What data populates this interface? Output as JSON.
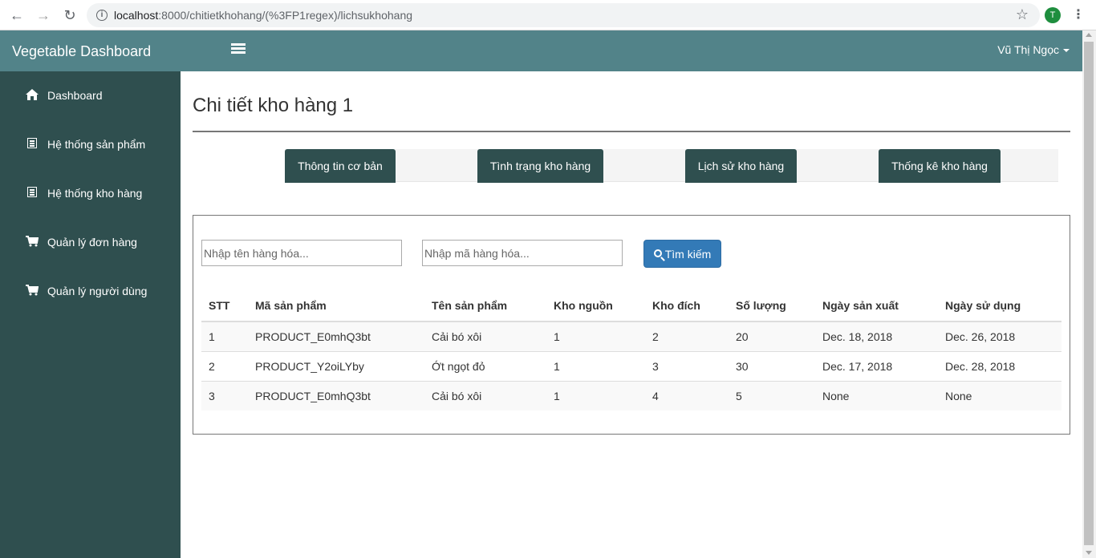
{
  "browser": {
    "url_host": "localhost",
    "url_path": ":8000/chitietkhohang/(%3FP1regex)/lichsukhohang",
    "profile_initial": "T"
  },
  "navbar": {
    "brand": "Vegetable Dashboard",
    "user_name": "Vũ Thị Ngọc"
  },
  "sidebar": {
    "items": [
      {
        "label": "Dashboard",
        "icon": "home-icon"
      },
      {
        "label": "Hệ thống sản phẩm",
        "icon": "list-icon"
      },
      {
        "label": "Hệ thống kho hàng",
        "icon": "list-icon"
      },
      {
        "label": "Quản lý đơn hàng",
        "icon": "cart-icon"
      },
      {
        "label": "Quản lý người dùng",
        "icon": "cart-icon"
      }
    ]
  },
  "main": {
    "title": "Chi tiết kho hàng 1",
    "tabs": [
      {
        "label": "Thông tin cơ bản"
      },
      {
        "label": "Tình trạng kho hàng"
      },
      {
        "label": "Lịch sử kho hàng"
      },
      {
        "label": "Thống kê kho hàng"
      }
    ],
    "search": {
      "name_placeholder": "Nhập tên hàng hóa...",
      "code_placeholder": "Nhập mã hàng hóa...",
      "button_label": "Tìm kiếm"
    },
    "table": {
      "headers": [
        "STT",
        "Mã sản phẩm",
        "Tên sản phẩm",
        "Kho nguồn",
        "Kho đích",
        "Số lượng",
        "Ngày sản xuất",
        "Ngày sử dụng"
      ],
      "rows": [
        [
          "1",
          "PRODUCT_E0mhQ3bt",
          "Cải bó xôi",
          "1",
          "2",
          "20",
          "Dec. 18, 2018",
          "Dec. 26, 2018"
        ],
        [
          "2",
          "PRODUCT_Y2oiLYby",
          "Ớt ngọt đỏ",
          "1",
          "3",
          "30",
          "Dec. 17, 2018",
          "Dec. 28, 2018"
        ],
        [
          "3",
          "PRODUCT_E0mhQ3bt",
          "Cải bó xôi",
          "1",
          "4",
          "5",
          "None",
          "None"
        ]
      ]
    }
  },
  "colors": {
    "navbar": "#528389",
    "sidebar": "#2f4f4f",
    "tab": "#2f4f4f",
    "button": "#337ab7"
  }
}
